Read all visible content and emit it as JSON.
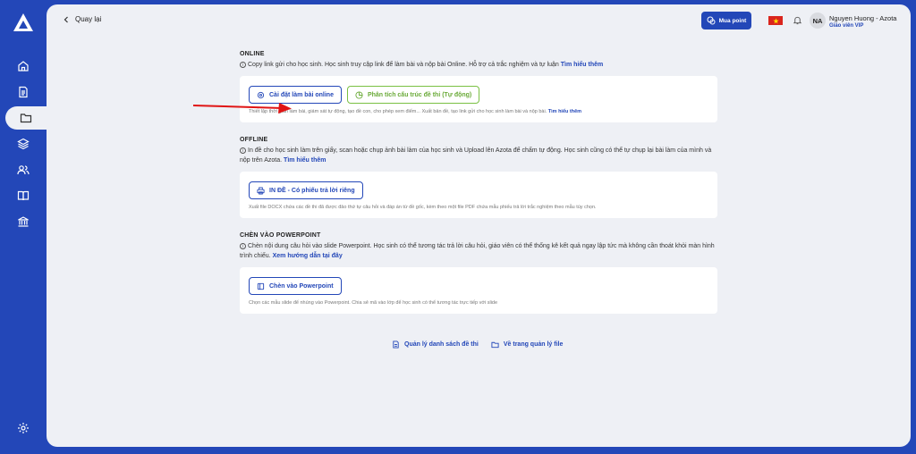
{
  "topbar": {
    "back_label": "Quay lại",
    "buy_point_label": "Mua point",
    "user_initials": "NA",
    "user_name": "Nguyen Huong - Azota",
    "user_role": "Giáo viên VIP"
  },
  "online": {
    "title": "ONLINE",
    "desc": "Copy link gửi cho học sinh. Học sinh truy cập link để làm bài và nộp bài Online. Hỗ trợ cả trắc nghiệm và tự luận",
    "link": "Tìm hiểu thêm",
    "btn_setup": "Cài đặt làm bài online",
    "btn_analyze": "Phân tích cấu trúc đề thi (Tự động)",
    "note": "Thiết lập thời gian làm bài, giám sát tự động, tạo đề con, cho phép xem điểm... Xuất bản đề, tạo link gửi cho học sinh làm bài và nộp bài.",
    "note_link": "Tìm hiểu thêm"
  },
  "offline": {
    "title": "OFFLINE",
    "desc": "In đề cho học sinh làm trên giấy, scan hoặc chụp ảnh bài làm của học sinh và Upload lên Azota để chấm tự động. Học sinh cũng có thể tự chụp lại bài làm của mình và nộp trên Azota.",
    "link": "Tìm hiểu thêm",
    "btn_print": "IN ĐỀ - Có phiếu trả lời riêng",
    "note": "Xuất file DOCX chứa các đề thi đã được đảo thứ tự câu hỏi và đáp án từ đề gốc, kèm theo một file PDF chứa mẫu phiếu trả lời trắc nghiệm theo mẫu tùy chọn."
  },
  "powerpoint": {
    "title": "CHÈN VÀO POWERPOINT",
    "desc": "Chèn nội dung câu hỏi vào slide Powerpoint. Học sinh có thể tương tác trả lời câu hỏi, giáo viên có thể thống kê kết quả ngay lập tức mà không cần thoát khỏi màn hình trình chiếu.",
    "link": "Xem hướng dẫn tại đây",
    "btn_insert": "Chèn vào Powerpoint",
    "note": "Chọn các mẫu slide để nhúng vào Powerpoint. Chia sẻ mã vào lớp để học sinh có thể tương tác trực tiếp với slide"
  },
  "footer_links": {
    "manage_exams": "Quản lý danh sách đề thi",
    "file_manager": "Về trang quản lý file"
  },
  "colors": {
    "brand": "#2347b8",
    "analyze_green": "#7ac043",
    "arrow": "#e01414"
  }
}
